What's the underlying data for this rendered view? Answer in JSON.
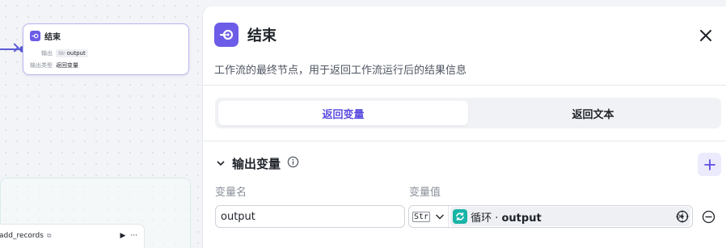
{
  "canvas": {
    "end_node": {
      "title": "结束",
      "output_label": "输出",
      "output_type": "Str",
      "output_name": "output",
      "output_kind_label": "输出类型",
      "output_kind_value": "返回变量"
    },
    "record_node": {
      "name": "add_records",
      "more": "···"
    }
  },
  "panel": {
    "title": "结束",
    "description": "工作流的最终节点，用于返回工作流运行后的结果信息",
    "tabs": [
      {
        "label": "返回变量",
        "active": true
      },
      {
        "label": "返回文本",
        "active": false
      }
    ],
    "output_section": {
      "title": "输出变量",
      "columns": {
        "name": "变量名",
        "value": "变量值"
      },
      "rows": [
        {
          "name": "output",
          "type_badge": "Str",
          "ref_source": "循环",
          "ref_separator": " · ",
          "ref_var": "output",
          "clear": "×"
        }
      ]
    }
  },
  "colors": {
    "accent": "#6c5ce7",
    "active_tab_text": "#5b4de0",
    "loop_icon": "#17b4a7"
  },
  "icons": {
    "end_node": "end-node-icon",
    "close": "close-icon",
    "info": "info-icon",
    "add": "plus-icon",
    "collapse": "chevron-down-icon",
    "loop": "loop-icon",
    "target": "target-icon",
    "remove": "minus-circle-icon"
  }
}
